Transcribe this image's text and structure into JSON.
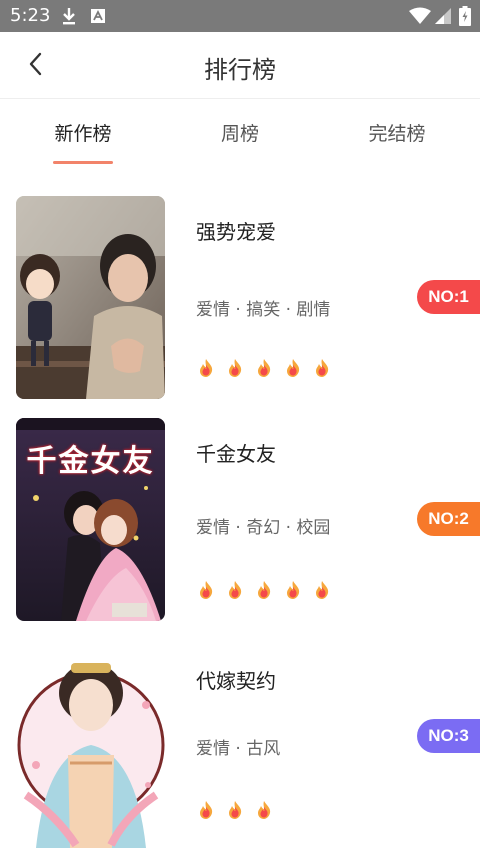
{
  "status": {
    "time": "5:23"
  },
  "header": {
    "title": "排行榜",
    "back_icon": "chevron-left-icon"
  },
  "tabs": [
    {
      "label": "新作榜",
      "active": true
    },
    {
      "label": "周榜",
      "active": false
    },
    {
      "label": "完结榜",
      "active": false
    }
  ],
  "colors": {
    "accent": "#f2836a",
    "rank1": "#f4494a",
    "rank2": "#f7792a",
    "rank3": "#7b6cf3"
  },
  "items": [
    {
      "title": "强势宠爱",
      "tags": "爱情 · 搞笑 · 剧情",
      "rank": "NO:1",
      "heat": 5
    },
    {
      "title": "千金女友",
      "tags": "爱情 · 奇幻 · 校园",
      "rank": "NO:2",
      "heat": 5
    },
    {
      "title": "代嫁契约",
      "tags": "爱情 · 古风",
      "rank": "NO:3",
      "heat": 3
    }
  ],
  "covers": [
    {
      "art": "千金女友"
    }
  ]
}
